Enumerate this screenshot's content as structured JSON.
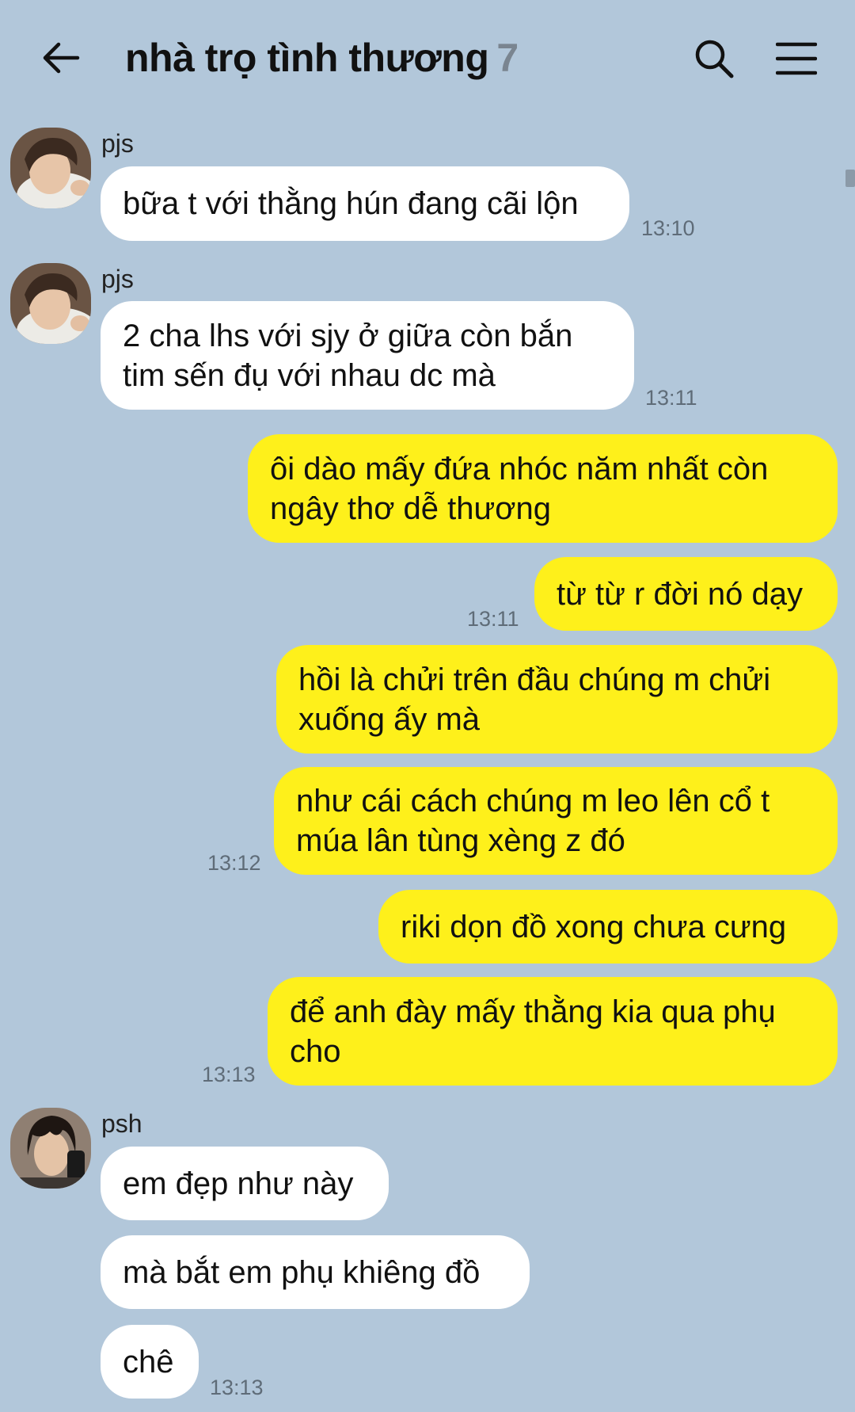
{
  "header": {
    "title": "nhà trọ tình thương",
    "member_count": "7"
  },
  "messages": [
    {
      "sender": "pjs",
      "text": "bữa t với thằng hún đang cãi lộn",
      "time": "13:10"
    },
    {
      "sender": "pjs",
      "text": "2 cha lhs với sjy ở giữa còn bắn\ntim sến đụ với nhau dc mà",
      "time": "13:11"
    },
    {
      "text": "ôi dào mấy đứa nhóc năm nhất còn\nngây thơ dễ thương"
    },
    {
      "text": "từ từ r đời nó dạy",
      "time": "13:11"
    },
    {
      "text": "hồi là chửi trên đầu chúng m chửi\nxuống ấy mà"
    },
    {
      "text": "như cái cách chúng m leo lên cổ t\nmúa lân tùng xèng z đó",
      "time": "13:12"
    },
    {
      "text": "riki dọn đồ xong chưa cưng"
    },
    {
      "text": "để anh đày mấy thằng kia qua phụ\ncho",
      "time": "13:13"
    },
    {
      "sender": "psh",
      "text": "em đẹp như này"
    },
    {
      "text": "mà bắt em phụ khiêng đồ"
    },
    {
      "text": "chê",
      "time": "13:13"
    }
  ]
}
